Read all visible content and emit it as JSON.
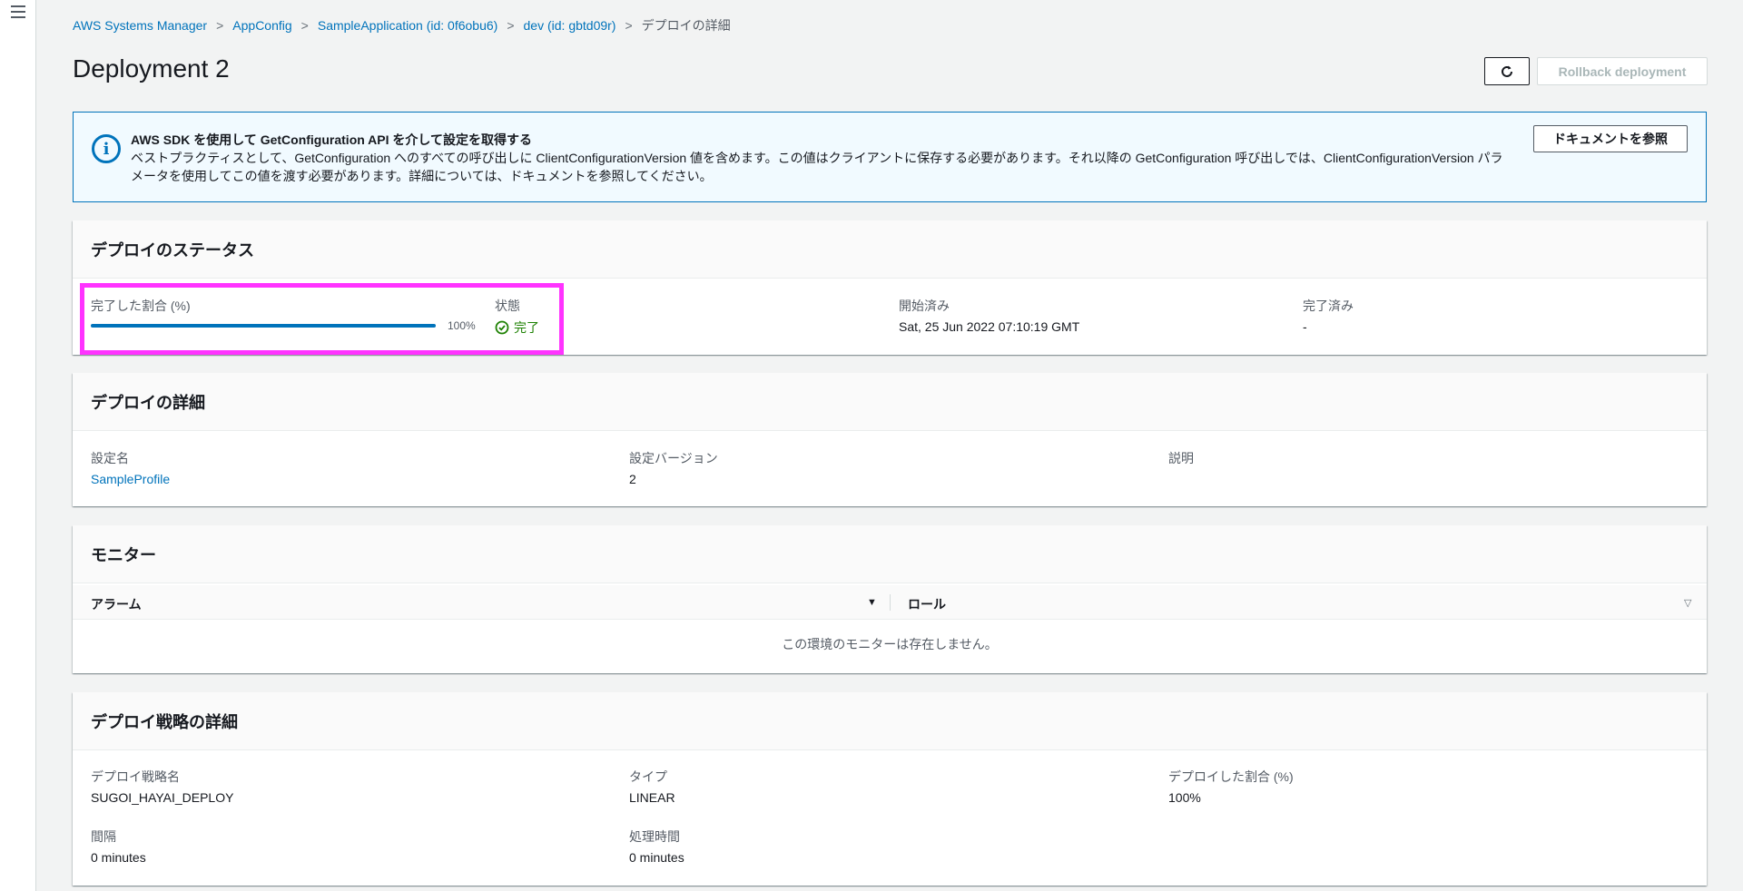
{
  "breadcrumb": {
    "items": [
      "AWS Systems Manager",
      "AppConfig",
      "SampleApplication (id: 0f6obu6)",
      "dev (id: gbtd09r)"
    ],
    "current": "デプロイの詳細"
  },
  "page_title": "Deployment 2",
  "header_actions": {
    "rollback_label": "Rollback deployment"
  },
  "info_alert": {
    "title": "AWS SDK を使用して GetConfiguration API を介して設定を取得する",
    "body": "ベストプラクティスとして、GetConfiguration へのすべての呼び出しに ClientConfigurationVersion 値を含めます。この値はクライアントに保存する必要があります。それ以降の GetConfiguration 呼び出しでは、ClientConfigurationVersion パラメータを使用してこの値を渡す必要があります。詳細については、ドキュメントを参照してください。",
    "button_label": "ドキュメントを参照"
  },
  "status_card": {
    "title": "デプロイのステータス",
    "progress_label": "完了した割合 (%)",
    "progress_text": "100%",
    "progress_fraction": 1.0,
    "state_label": "状態",
    "state_value": "完了",
    "started_label": "開始済み",
    "started_value": "Sat, 25 Jun 2022 07:10:19 GMT",
    "completed_label": "完了済み",
    "completed_value": "-"
  },
  "details_card": {
    "title": "デプロイの詳細",
    "config_name_label": "設定名",
    "config_name_value": "SampleProfile",
    "config_version_label": "設定バージョン",
    "config_version_value": "2",
    "description_label": "説明"
  },
  "monitor_card": {
    "title": "モニター",
    "columns": [
      "アラーム",
      "ロール"
    ],
    "empty_text": "この環境のモニターは存在しません。"
  },
  "strategy_card": {
    "title": "デプロイ戦略の詳細",
    "name_label": "デプロイ戦略名",
    "name_value": "SUGOI_HAYAI_DEPLOY",
    "type_label": "タイプ",
    "type_value": "LINEAR",
    "percent_label": "デプロイした割合 (%)",
    "percent_value": "100%",
    "interval_label": "間隔",
    "interval_value": "0 minutes",
    "duration_label": "処理時間",
    "duration_value": "0 minutes"
  },
  "colors": {
    "link": "#0073bb",
    "success": "#1d8102",
    "highlight": "#ff33ff",
    "info_bg": "#f1faff"
  },
  "icons": [
    "hamburger-icon",
    "chevron-right-icon",
    "refresh-icon",
    "info-icon",
    "check-circle-icon",
    "sort-down-icon",
    "sort-down-outline-icon"
  ]
}
